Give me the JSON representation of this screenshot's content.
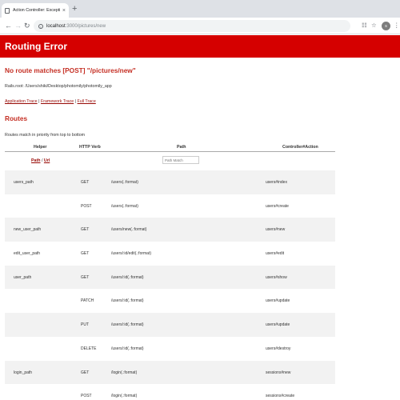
{
  "browser": {
    "tab_title": "Action Controller: Exception c",
    "tab_close": "×",
    "new_tab": "+",
    "url_host": "localhost",
    "url_path": ":3000/pictures/new",
    "avatar_text": "S",
    "icons": [
      "file-icon",
      "back-icon",
      "forward-icon",
      "reload-icon",
      "info-icon",
      "translate-icon",
      "star-icon",
      "profile-icon",
      "menu-icon"
    ]
  },
  "page": {
    "banner_title": "Routing Error",
    "error_title": "No route matches [POST] \"/pictures/new\"",
    "rails_root": "Rails.root: /Users/shiki/Desktop/photomily/photomily_app",
    "traces": {
      "application": "Application Trace",
      "separator1": " | ",
      "framework": "Framework Trace",
      "separator2": " | ",
      "full": "Full Trace"
    },
    "routes_title": "Routes",
    "routes_note": "Routes match in priority from top to bottom",
    "table": {
      "headers": {
        "helper": "Helper",
        "verb": "HTTP Verb",
        "path": "Path",
        "controller": "Controller#Action"
      },
      "filter": {
        "path_link": "Path",
        "separator": " / ",
        "url_link": "Url",
        "match_placeholder": "Path Match"
      },
      "rows": [
        {
          "helper": "users_path",
          "verb": "GET",
          "path": "/users(.:format)",
          "action": "users#index"
        },
        {
          "helper": "",
          "verb": "POST",
          "path": "/users(.:format)",
          "action": "users#create"
        },
        {
          "helper": "new_user_path",
          "verb": "GET",
          "path": "/users/new(.:format)",
          "action": "users#new"
        },
        {
          "helper": "edit_user_path",
          "verb": "GET",
          "path": "/users/:id/edit(.:format)",
          "action": "users#edit"
        },
        {
          "helper": "user_path",
          "verb": "GET",
          "path": "/users/:id(.:format)",
          "action": "users#show"
        },
        {
          "helper": "",
          "verb": "PATCH",
          "path": "/users/:id(.:format)",
          "action": "users#update"
        },
        {
          "helper": "",
          "verb": "PUT",
          "path": "/users/:id(.:format)",
          "action": "users#update"
        },
        {
          "helper": "",
          "verb": "DELETE",
          "path": "/users/:id(.:format)",
          "action": "users#destroy"
        },
        {
          "helper": "login_path",
          "verb": "GET",
          "path": "/login(.:format)",
          "action": "sessions#new"
        },
        {
          "helper": "",
          "verb": "POST",
          "path": "/login(.:format)",
          "action": "sessions#create"
        }
      ]
    }
  }
}
